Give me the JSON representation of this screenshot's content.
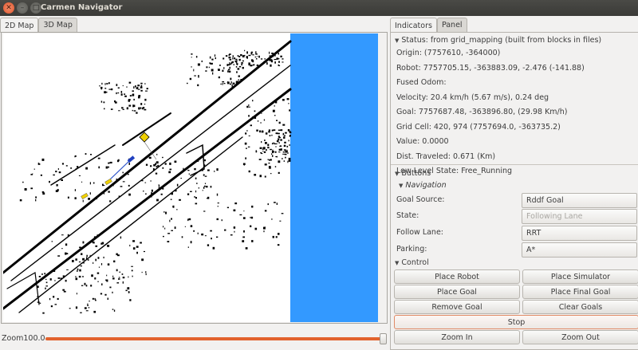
{
  "window": {
    "title": "Carmen Navigator"
  },
  "left_tabs": [
    {
      "label": "2D Map"
    },
    {
      "label": "3D Map"
    }
  ],
  "zoom": {
    "label": "Zoom100.0",
    "value": 100.0
  },
  "right_tabs": [
    {
      "label": "Indicators"
    },
    {
      "label": "Panel"
    }
  ],
  "status": {
    "header": "Status: from grid_mapping (built from blocks in files)",
    "lines": [
      "Origin: (7757610, -364000)",
      "Robot: 7757705.15, -363883.09, -2.476 (-141.88)",
      "Fused Odom:",
      "Velocity:  20.4 km/h (5.67 m/s), 0.24 deg",
      "Goal: 7757687.48, -363896.80, (29.98 Km/h)",
      "Grid Cell: 420, 974  (7757694.0, -363735.2)",
      "Value: 0.0000",
      "Dist. Traveled: 0.671 (Km)",
      "Low Level State: Free_Running"
    ]
  },
  "buttons_section": {
    "label": "Buttons"
  },
  "navigation": {
    "label": "Navigation",
    "goal_source": {
      "label": "Goal Source:",
      "value": "Rddf Goal"
    },
    "state": {
      "label": "State:",
      "value": "Following Lane"
    },
    "follow_lane": {
      "label": "Follow Lane:",
      "value": "RRT"
    },
    "parking": {
      "label": "Parking:",
      "value": "A*"
    }
  },
  "control": {
    "label": "Control",
    "place_robot": "Place Robot",
    "place_simulator": "Place Simulator",
    "place_goal": "Place Goal",
    "place_final_goal": "Place Final Goal",
    "remove_goal": "Remove Goal",
    "clear_goals": "Clear Goals",
    "stop": "Stop",
    "zoom_in": "Zoom In",
    "zoom_out": "Zoom Out"
  },
  "colors": {
    "map_unknown": "#3399ff",
    "slider_accent": "#e2622d",
    "close_button": "#e0552c",
    "car_marker": "#f0d000",
    "robot_marker": "#2040c0"
  }
}
